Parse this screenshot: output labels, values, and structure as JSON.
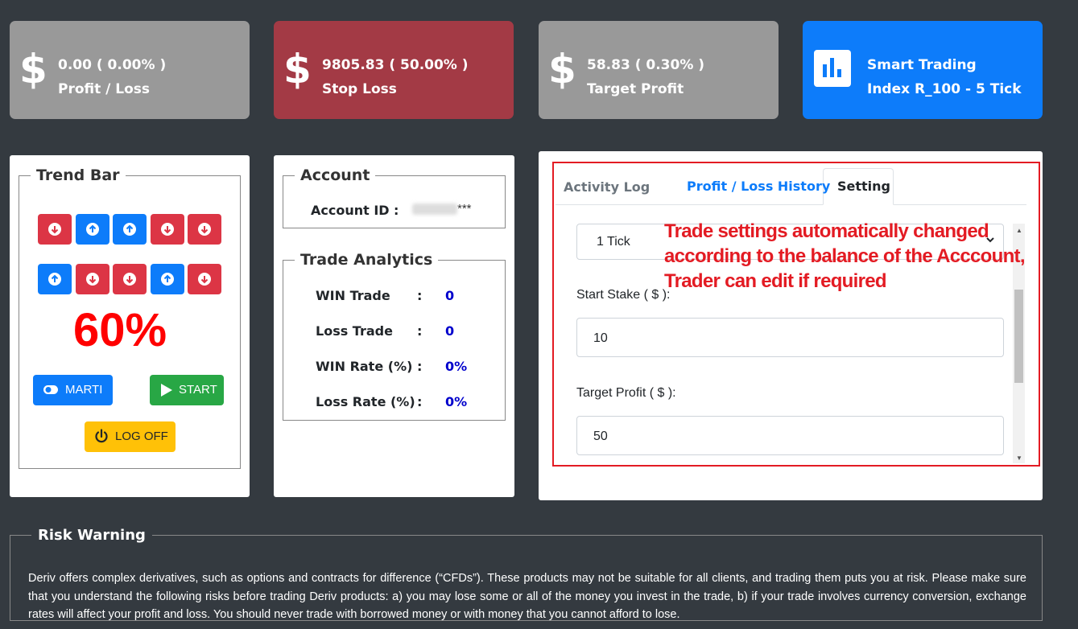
{
  "cards": {
    "profit_loss": {
      "value": "0.00 ( 0.00% )",
      "label": "Profit / Loss",
      "color": "#999999"
    },
    "stop_loss": {
      "value": "9805.83 ( 50.00% )",
      "label": "Stop Loss",
      "color": "#a33a45"
    },
    "target_profit": {
      "value": "58.83 ( 0.30% )",
      "label": "Target Profit",
      "color": "#999999"
    },
    "smart_trading": {
      "title": "Smart Trading",
      "subtitle": "Index R_100 - 5 Tick",
      "color": "#0d7cfa"
    },
    "dollar_symbol": "$"
  },
  "trend_bar": {
    "title": "Trend Bar",
    "row1": [
      "down",
      "up",
      "up",
      "down",
      "down"
    ],
    "row2": [
      "up",
      "down",
      "down",
      "up",
      "down"
    ],
    "percentage": "60%",
    "buttons": {
      "marti": "MARTI",
      "start": "START",
      "log_off": "LOG OFF"
    }
  },
  "account": {
    "title": "Account",
    "id_label": "Account ID",
    "colon": ":",
    "id_suffix": "***"
  },
  "trade_analytics": {
    "title": "Trade Analytics",
    "rows": [
      {
        "label": "WIN Trade",
        "value": "0"
      },
      {
        "label": "Loss Trade",
        "value": "0"
      },
      {
        "label": "WIN Rate (%)",
        "value": "0%"
      },
      {
        "label": "Loss Rate (%)",
        "value": "0%"
      }
    ]
  },
  "tabs": {
    "activity_log": "Activity Log",
    "profit_loss_history": "Profit / Loss History",
    "setting": "Setting",
    "active": "setting"
  },
  "settings": {
    "tick_select": "1 Tick",
    "start_stake_label": "Start Stake ( $ ):",
    "start_stake_value": "10",
    "target_profit_label": "Target Profit ( $ ):",
    "target_profit_value": "50"
  },
  "annotation": "Trade settings automatically changed according to the balance of the Acccount, Trader can edit if required",
  "risk_warning": {
    "title": "Risk Warning",
    "text": "Deriv offers complex derivatives, such as options and contracts for difference (“CFDs”). These products may not be suitable for all clients, and trading them puts you at risk. Please make sure that you understand the following risks before trading Deriv products: a) you may lose some or all of the money you invest in the trade, b) if your trade involves currency conversion, exchange rates will affect your profit and loss. You should never trade with borrowed money or with money that you cannot afford to lose."
  }
}
